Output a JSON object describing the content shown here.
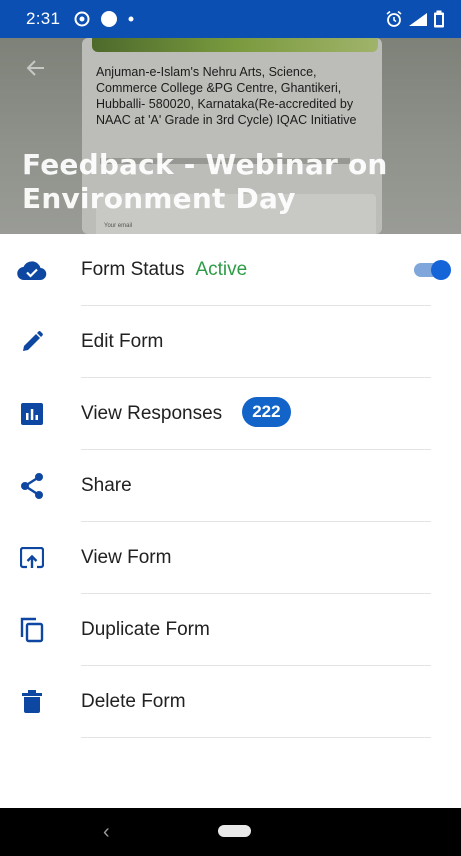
{
  "status_bar": {
    "time": "2:31",
    "left_icons": [
      "sync-icon",
      "circle-icon",
      "dot-icon"
    ],
    "right_icons": [
      "alarm-icon",
      "signal-icon",
      "battery-icon"
    ],
    "color": "#0b4fb3"
  },
  "header": {
    "title": "Feedback - Webinar on Environment Day",
    "preview_text": "Anjuman-e-Islam's Nehru Arts, Science, Commerce College &PG Centre, Ghantikeri, Hubballi- 580020, Karnataka(Re-accredited by NAAC at 'A' Grade in 3rd Cycle) IQAC Initiative",
    "preview_email": "Your email"
  },
  "menu": {
    "form_status": {
      "label": "Form Status",
      "value": "Active",
      "toggle_on": true
    },
    "edit_form": {
      "label": "Edit Form"
    },
    "view_responses": {
      "label": "View Responses",
      "count": "222"
    },
    "share": {
      "label": "Share"
    },
    "view_form": {
      "label": "View Form"
    },
    "duplicate_form": {
      "label": "Duplicate Form"
    },
    "delete_form": {
      "label": "Delete Form"
    }
  },
  "colors": {
    "accent": "#1264c9",
    "icon": "#0d47a1",
    "active": "#2e9c46"
  }
}
